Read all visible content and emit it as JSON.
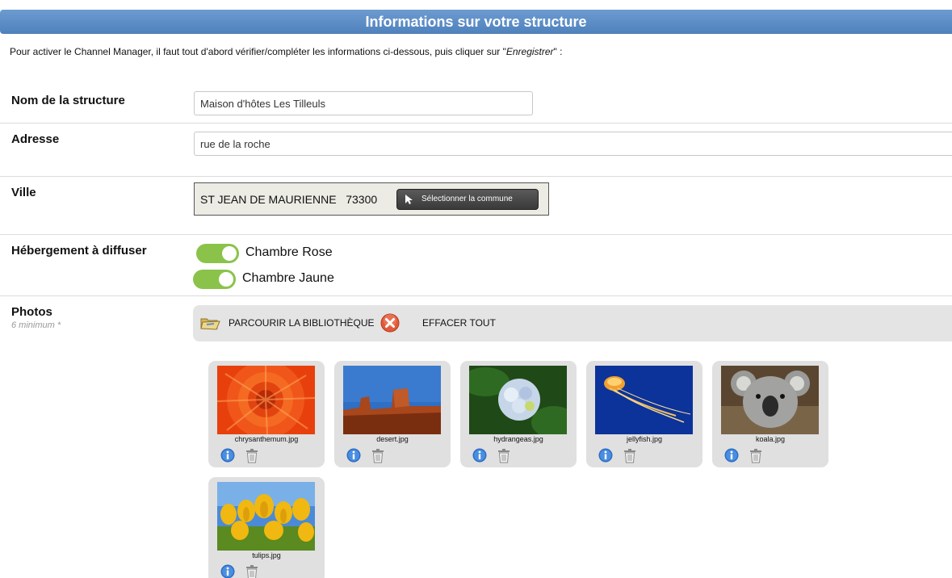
{
  "header": {
    "title": "Informations sur votre structure"
  },
  "intro": {
    "text_before": "Pour activer le Channel Manager, il faut tout d'abord vérifier/compléter les informations ci-dessous, puis cliquer sur \"",
    "emphasis": "Enregistrer",
    "text_after": "\" :"
  },
  "form": {
    "nom": {
      "label": "Nom de la structure",
      "value": "Maison d'hôtes Les Tilleuls"
    },
    "adresse": {
      "label": "Adresse",
      "value": "rue de la roche"
    },
    "ville": {
      "label": "Ville",
      "value": "ST JEAN DE MAURIENNE   73300",
      "button_label": "Sélectionner la commune"
    },
    "hebergement": {
      "label": "Hébergement à diffuser",
      "items": [
        {
          "label": "Chambre Rose",
          "enabled": true
        },
        {
          "label": "Chambre Jaune",
          "enabled": true
        }
      ]
    },
    "photos": {
      "label": "Photos",
      "sublabel": "6 minimum *",
      "browse_label": "PARCOURIR LA BIBLIOTHÈQUE",
      "clear_label": "EFFACER TOUT",
      "items": [
        {
          "filename": "chrysanthemum.jpg"
        },
        {
          "filename": "desert.jpg"
        },
        {
          "filename": "hydrangeas.jpg"
        },
        {
          "filename": "jellyfish.jpg"
        },
        {
          "filename": "koala.jpg"
        },
        {
          "filename": "tulips.jpg"
        }
      ]
    }
  },
  "colors": {
    "banner": "#5588c4",
    "toggle_on": "#8bc34a",
    "card_bg": "#e0e0e0",
    "info_blue": "#2b6cc4"
  }
}
